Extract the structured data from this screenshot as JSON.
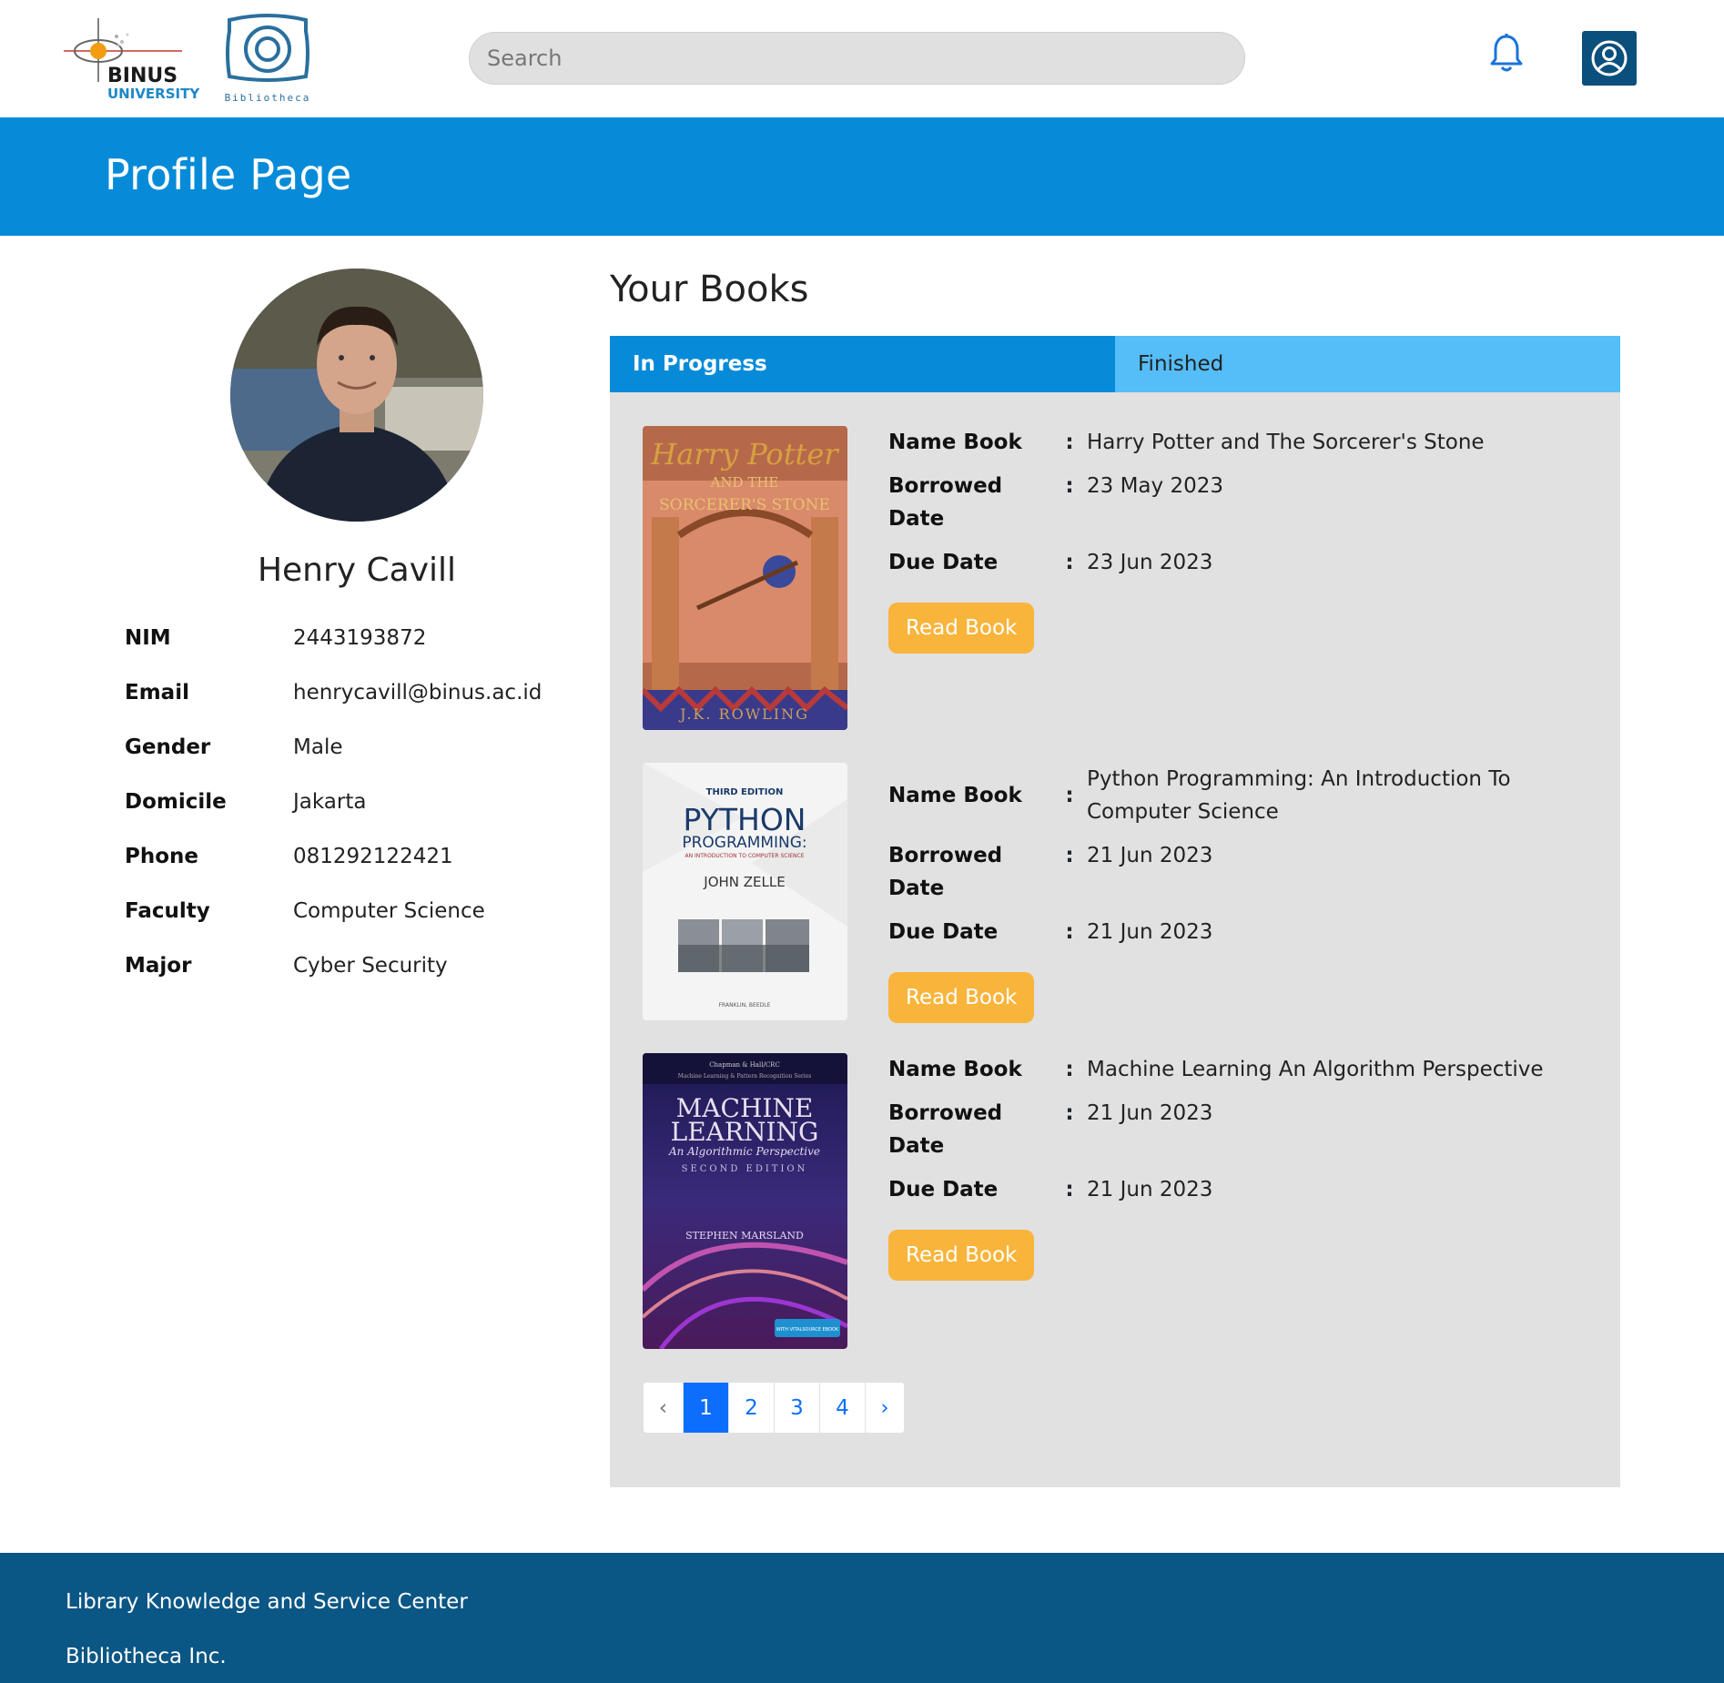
{
  "header": {
    "logo_text": "BINUS",
    "logo_subtext": "UNIVERSITY",
    "biblio_text": "Bibliotheca",
    "search_placeholder": "Search",
    "icons": {
      "notification": "bell-icon",
      "profile": "user-circle-icon"
    }
  },
  "banner": {
    "title": "Profile Page"
  },
  "profile": {
    "name": "Henry Cavill",
    "fields": [
      {
        "label": "NIM",
        "value": "2443193872"
      },
      {
        "label": "Email",
        "value": "henrycavill@binus.ac.id"
      },
      {
        "label": "Gender",
        "value": "Male"
      },
      {
        "label": "Domicile",
        "value": "Jakarta"
      },
      {
        "label": "Phone",
        "value": "081292122421"
      },
      {
        "label": "Faculty",
        "value": "Computer Science"
      },
      {
        "label": "Major",
        "value": "Cyber Security"
      }
    ]
  },
  "books": {
    "title": "Your Books",
    "tabs": [
      {
        "label": "In Progress",
        "active": true
      },
      {
        "label": "Finished",
        "active": false
      }
    ],
    "labels": {
      "name": "Name Book",
      "borrowed": "Borrowed Date",
      "due": "Due Date",
      "colon": ":"
    },
    "read_button": "Read Book",
    "items": [
      {
        "name": "Harry Potter and The Sorcerer's Stone",
        "borrowed": "23 May 2023",
        "due": "23 Jun 2023",
        "cover": {
          "title_1": "Harry Potter",
          "title_2": "AND THE",
          "title_3": "SORCERER'S STONE",
          "author": "J.K. ROWLING"
        }
      },
      {
        "name": "Python Programming: An Introduction To Computer Science",
        "borrowed": "21 Jun 2023",
        "due": "21 Jun 2023",
        "cover": {
          "edition": "THIRD EDITION",
          "title_1": "PYTHON",
          "title_2": "PROGRAMMING:",
          "subtitle": "AN INTRODUCTION TO COMPUTER SCIENCE",
          "author": "JOHN ZELLE",
          "publisher": "FRANKLIN, BEEDLE"
        }
      },
      {
        "name": "Machine Learning An Algorithm Perspective",
        "borrowed": "21 Jun 2023",
        "due": "21 Jun 2023",
        "cover": {
          "series": "Chapman & Hall/CRC",
          "series_2": "Machine Learning & Pattern Recognition Series",
          "title_1": "MACHINE",
          "title_2": "LEARNING",
          "subtitle": "An Algorithmic Perspective",
          "edition": "SECOND EDITION",
          "author": "STEPHEN MARSLAND",
          "badge": "WITH VITALSOURCE EBOOK"
        }
      }
    ],
    "pagination": {
      "prev": "‹",
      "pages": [
        "1",
        "2",
        "3",
        "4"
      ],
      "current": "1",
      "next": "›"
    }
  },
  "footer": {
    "line1": "Library Knowledge and Service Center",
    "line2": "Bibliotheca Inc."
  },
  "colors": {
    "banner": "#078bd9",
    "tab_inactive": "#55bdf7",
    "panel": "#e1e1e1",
    "button": "#f9b43b",
    "footer": "#0a5684",
    "user_button": "#0b4f7c"
  }
}
